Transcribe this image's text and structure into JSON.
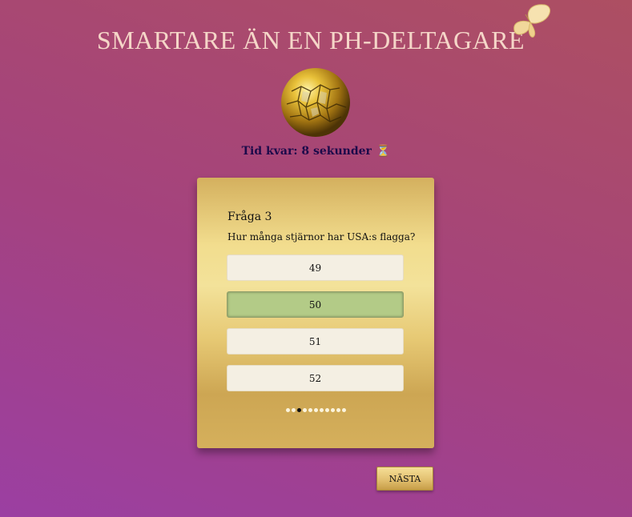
{
  "header": {
    "title": "SMARTARE ÄN EN PH-DELTAGARE"
  },
  "timer": {
    "label": "Tid kvar: 8 sekunder",
    "icon": "hourglass-icon",
    "glyph": "⏳"
  },
  "question": {
    "number_label": "Fråga 3",
    "text": "Hur många stjärnor har USA:s flagga?",
    "options": [
      {
        "label": "49",
        "selected": false
      },
      {
        "label": "50",
        "selected": true
      },
      {
        "label": "51",
        "selected": false
      },
      {
        "label": "52",
        "selected": false
      }
    ]
  },
  "progress": {
    "total": 11,
    "current": 3
  },
  "footer": {
    "next_label": "NÄSTA"
  },
  "colors": {
    "card_gold": "#f2dd8e",
    "selected_option": "#b3cb87",
    "option_background": "#f4efe3",
    "timer_text": "#1c0a4a",
    "title_text": "#f5d6c8"
  }
}
